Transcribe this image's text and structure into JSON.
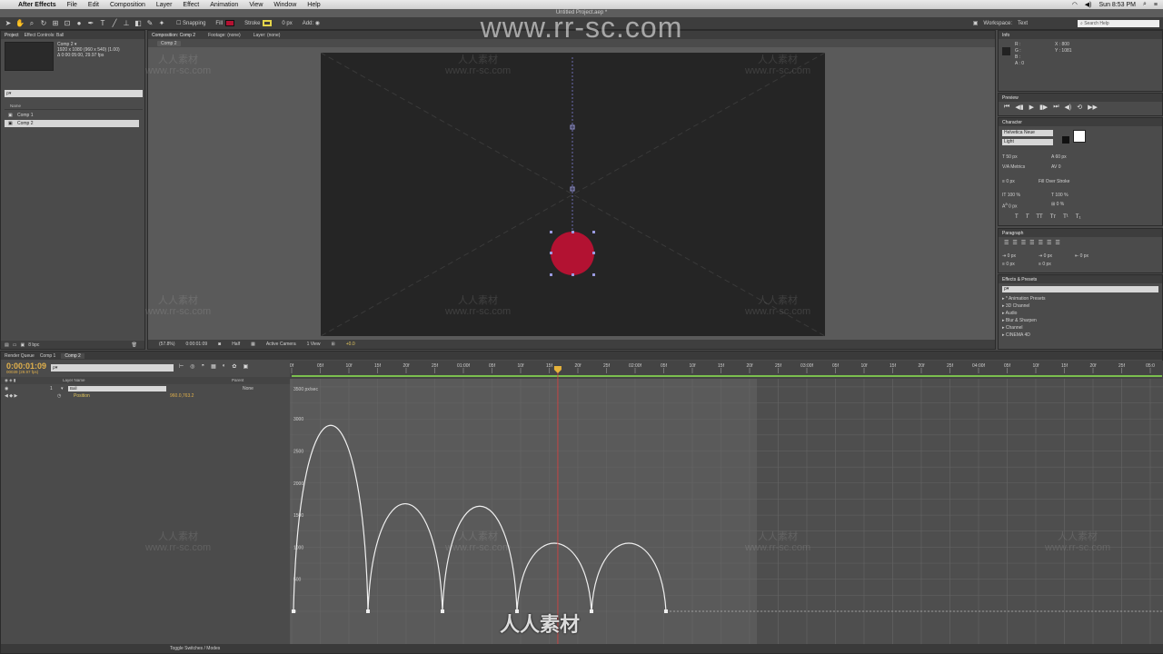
{
  "menubar": {
    "app": "After Effects",
    "items": [
      "File",
      "Edit",
      "Composition",
      "Layer",
      "Effect",
      "Animation",
      "View",
      "Window",
      "Help"
    ],
    "clock": "Sun 8:53 PM"
  },
  "window_title": "Untitled Project.aep *",
  "toolbar": {
    "snapping": "Snapping",
    "fill": "Fill",
    "stroke": "Stroke",
    "stroke_width": "0 px",
    "add": "Add:",
    "workspace_label": "Workspace:",
    "workspace_value": "Text",
    "search_help": "Search Help",
    "colors": {
      "fill": "#b31232",
      "stroke": "#e4d44a"
    }
  },
  "project": {
    "tab": "Project",
    "tab2": "Effect Controls: Ball",
    "comp_name": "Comp 2 ▾",
    "comp_info1": "1920 x 1080 (960 x 540) (1.00)",
    "comp_info2": "Δ 0:00:05:00, 29.97 fps",
    "search": "ρ▾",
    "name_header": "Name",
    "items": [
      "Comp 1",
      "Comp 2"
    ],
    "bpc": "8 bpc"
  },
  "composition": {
    "tab": "Composition: Comp 2",
    "footage": "Footage: (none)",
    "layer": "Layer: (none)",
    "crumb": "Comp 2",
    "footer": {
      "zoom": "(57.8%)",
      "time": "0:00:01:09",
      "resolution": "Half",
      "camera": "Active Camera",
      "views": "1 View",
      "exposure": "+0.0"
    }
  },
  "info": {
    "tab": "Info",
    "r": "R :",
    "g": "G :",
    "b": "B :",
    "a": "A : 0",
    "x": "X : 800",
    "y": "Y : 1081"
  },
  "preview": {
    "tab": "Preview"
  },
  "character": {
    "tab": "Character",
    "font": "Helvetica Neue",
    "style": "Light",
    "size": "50 px",
    "leading": "60 px",
    "kerning": "Metrics",
    "tracking": "0",
    "stroke_width": "0 px",
    "stroke_mode": "Fill Over Stroke",
    "vscale": "100 %",
    "hscale": "100 %",
    "baseline": "0 px",
    "tsume": "0 %"
  },
  "paragraph": {
    "tab": "Paragraph",
    "indent_left": "0 px",
    "indent_first": "0 px",
    "indent_right": "0 px",
    "space_before": "0 px",
    "space_after": "0 px"
  },
  "effects": {
    "tab": "Effects & Presets",
    "search": "ρ▾",
    "items": [
      "* Animation Presets",
      "3D Channel",
      "Audio",
      "Blur & Sharpen",
      "Channel",
      "CINEMA 4D"
    ]
  },
  "timeline": {
    "tabs": [
      "Render Queue",
      "Comp 1",
      "Comp 2"
    ],
    "timecode": "0:00:01:09",
    "frame_info": "00039 (29.97 fps)",
    "search": "ρ▾",
    "layer_header": "Layer Name",
    "parent_header": "Parent",
    "layer_num": "1",
    "layer_name": "Ball",
    "parent_value": "None",
    "property": "Position",
    "property_value": "960.0,763.2",
    "toggle_label": "Toggle Switches / Modes",
    "ruler_labels": [
      "0f",
      "05f",
      "10f",
      "15f",
      "20f",
      "25f",
      "01:00f",
      "05f",
      "10f",
      "15f",
      "20f",
      "25f",
      "02:00f",
      "05f",
      "10f",
      "15f",
      "20f",
      "25f",
      "03:00f",
      "05f",
      "10f",
      "15f",
      "20f",
      "25f",
      "04:00f",
      "05f",
      "10f",
      "15f",
      "20f",
      "25f",
      "05:0"
    ],
    "graph_unit": "3500 px/sec",
    "y_ticks": [
      "3000",
      "2500",
      "2000",
      "1500",
      "1000",
      "500",
      "0"
    ]
  },
  "watermark": {
    "url": "www.rr-sc.com",
    "cn": "人人素材",
    "logo": "人人素材"
  }
}
